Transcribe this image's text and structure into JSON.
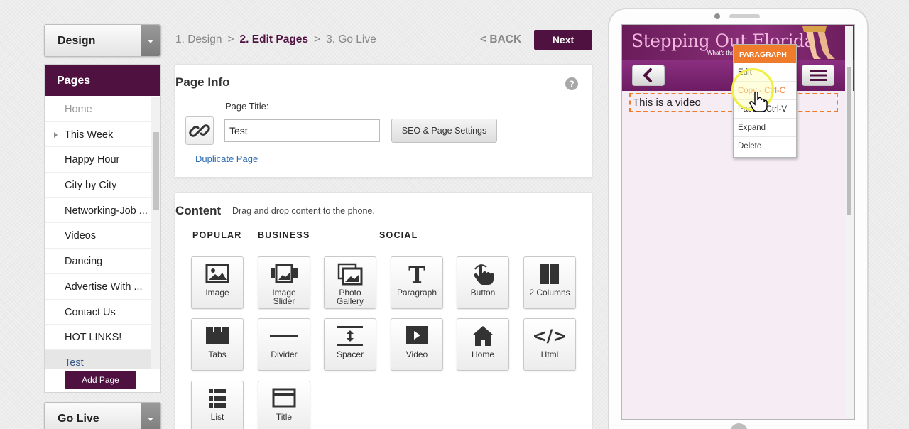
{
  "sidebar": {
    "design_label": "Design",
    "pages_header": "Pages",
    "pages": [
      {
        "label": "Home",
        "state": "muted"
      },
      {
        "label": "This Week",
        "state": "expandable"
      },
      {
        "label": "Happy Hour",
        "state": "normal"
      },
      {
        "label": "City by City",
        "state": "normal"
      },
      {
        "label": "Networking-Job ...",
        "state": "normal"
      },
      {
        "label": "Videos",
        "state": "normal"
      },
      {
        "label": "Dancing",
        "state": "normal"
      },
      {
        "label": "Advertise With ...",
        "state": "normal"
      },
      {
        "label": "Contact Us",
        "state": "normal"
      },
      {
        "label": "HOT LINKS!",
        "state": "normal"
      },
      {
        "label": "Test",
        "state": "active"
      }
    ],
    "add_page_label": "Add Page",
    "golive_label": "Go Live"
  },
  "steps": {
    "step1": "1. Design",
    "step2": "2. Edit Pages",
    "step3": "3. Go Live",
    "separator": ">",
    "back_label": "< BACK",
    "next_label": "Next"
  },
  "page_info": {
    "title": "Page Info",
    "help_icon": "?",
    "page_title_label": "Page Title:",
    "page_title_value": "Test",
    "seo_button": "SEO & Page Settings",
    "duplicate_link": "Duplicate Page"
  },
  "content": {
    "title": "Content",
    "subtitle": "Drag and drop content to the phone.",
    "categories": [
      "POPULAR",
      "BUSINESS",
      "SOCIAL"
    ],
    "tiles": [
      {
        "label": "Image",
        "icon": "image-icon"
      },
      {
        "label": "Image\nSlider",
        "icon": "image-slider-icon"
      },
      {
        "label": "Photo\nGallery",
        "icon": "photo-gallery-icon"
      },
      {
        "label": "Paragraph",
        "icon": "paragraph-icon"
      },
      {
        "label": "Button",
        "icon": "button-hand-icon"
      },
      {
        "label": "2 Columns",
        "icon": "two-columns-icon"
      },
      {
        "label": "Tabs",
        "icon": "tabs-icon"
      },
      {
        "label": "Divider",
        "icon": "divider-icon"
      },
      {
        "label": "Spacer",
        "icon": "spacer-icon"
      },
      {
        "label": "Video",
        "icon": "video-icon"
      },
      {
        "label": "Home",
        "icon": "home-icon"
      },
      {
        "label": "Html",
        "icon": "html-icon"
      },
      {
        "label": "List",
        "icon": "list-icon"
      },
      {
        "label": "Title",
        "icon": "title-icon"
      }
    ]
  },
  "phone": {
    "banner_title": "Stepping Out Florida",
    "banner_subtitle": "What's the",
    "paragraph_text": "This is a video",
    "context_menu": {
      "header": "PARAGRAPH",
      "items": [
        {
          "label": "Edit",
          "highlight": false
        },
        {
          "label": "Copy - Ctrl-C",
          "highlight": true
        },
        {
          "label": "Paste - Ctrl-V",
          "highlight": false
        },
        {
          "label": "Expand",
          "highlight": false
        },
        {
          "label": "Delete",
          "highlight": false
        }
      ]
    }
  },
  "colors": {
    "brand": "#4e1140",
    "accent": "#ee7c2c",
    "link": "#2c6db0"
  }
}
